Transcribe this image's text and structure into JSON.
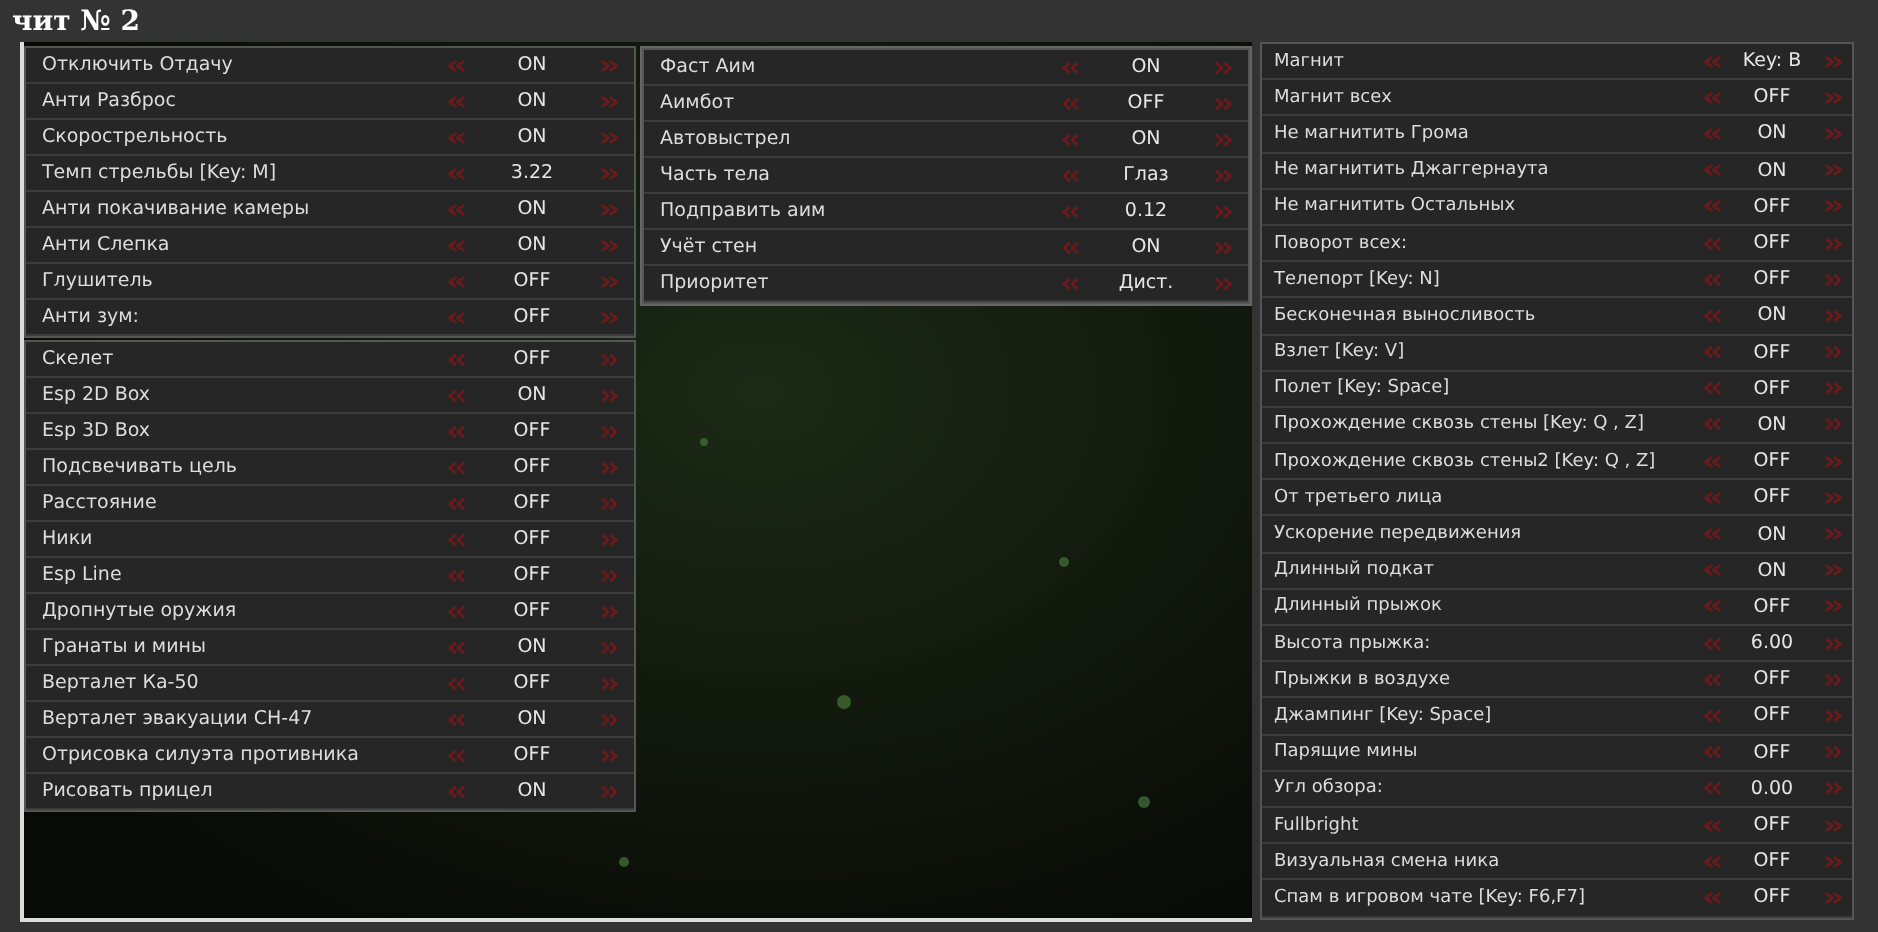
{
  "title": "чит № 2",
  "columns": [
    {
      "groups": [
        {
          "rows": [
            {
              "label": "Отключить Отдачу",
              "value": "ON"
            },
            {
              "label": "Анти Разброс",
              "value": "ON"
            },
            {
              "label": "Скорострельность",
              "value": "ON"
            },
            {
              "label": "Темп стрельбы [Key: M]",
              "value": "3.22"
            },
            {
              "label": "Анти покачивание камеры",
              "value": "ON"
            },
            {
              "label": "Анти Слепка",
              "value": "ON"
            },
            {
              "label": "Глушитель",
              "value": "OFF"
            },
            {
              "label": "Анти зум:",
              "value": "OFF"
            }
          ]
        },
        {
          "rows": [
            {
              "label": "Скелет",
              "value": "OFF"
            },
            {
              "label": "Esp 2D Box",
              "value": "ON"
            },
            {
              "label": "Esp 3D Box",
              "value": "OFF"
            },
            {
              "label": "Подсвечивать цель",
              "value": "OFF"
            },
            {
              "label": "Расстояние",
              "value": "OFF"
            },
            {
              "label": "Ники",
              "value": "OFF"
            },
            {
              "label": "Esp Line",
              "value": "OFF"
            },
            {
              "label": "Дропнутые оружия",
              "value": "OFF"
            },
            {
              "label": "Гранаты и мины",
              "value": "ON"
            },
            {
              "label": "Верталет Ка-50",
              "value": "OFF"
            },
            {
              "label": "Верталет эвакуации CH-47",
              "value": "ON"
            },
            {
              "label": "Отрисовка силуэта противника",
              "value": "OFF"
            },
            {
              "label": "Рисовать прицел",
              "value": "ON"
            }
          ]
        }
      ]
    },
    {
      "groups": [
        {
          "rows": [
            {
              "label": "Фаст Аим",
              "value": "ON"
            },
            {
              "label": "Аимбот",
              "value": "OFF"
            },
            {
              "label": "Автовыстрел",
              "value": "ON"
            },
            {
              "label": "Часть тела",
              "value": "Глаз"
            },
            {
              "label": "Подправить аим",
              "value": "0.12"
            },
            {
              "label": "Учёт стен",
              "value": "ON"
            },
            {
              "label": "Приоритет",
              "value": "Дист."
            }
          ]
        }
      ]
    },
    {
      "groups": [
        {
          "rows": [
            {
              "label": "Магнит",
              "value": "Key: B"
            },
            {
              "label": "Магнит всех",
              "value": "OFF"
            },
            {
              "label": "Не магнитить Грома",
              "value": "ON"
            },
            {
              "label": "Не магнитить Джаггернаута",
              "value": "ON"
            },
            {
              "label": "Не магнитить Остальных",
              "value": "OFF"
            },
            {
              "label": "Поворот всех:",
              "value": "OFF"
            },
            {
              "label": "Телепорт [Key: N]",
              "value": "OFF"
            },
            {
              "label": "Бесконечная выносливость",
              "value": "ON"
            },
            {
              "label": "Взлет [Key: V]",
              "value": "OFF"
            },
            {
              "label": "Полет [Key: Space]",
              "value": "OFF"
            },
            {
              "label": "Прохождение сквозь стены [Key: Q , Z]",
              "value": "ON"
            },
            {
              "label": "Прохождение сквозь стены2 [Key: Q , Z]",
              "value": "OFF"
            },
            {
              "label": "От третьего лица",
              "value": "OFF"
            },
            {
              "label": "Ускорение передвижения",
              "value": "ON"
            },
            {
              "label": "Длинный подкат",
              "value": "ON"
            },
            {
              "label": "Длинный прыжок",
              "value": "OFF"
            },
            {
              "label": "Высота прыжка:",
              "value": "6.00"
            },
            {
              "label": "Прыжки в воздухе",
              "value": "OFF"
            },
            {
              "label": "Джампинг [Key: Space]",
              "value": "OFF"
            },
            {
              "label": "Парящие мины",
              "value": "OFF"
            },
            {
              "label": "Угл обзора:",
              "value": "0.00"
            },
            {
              "label": "Fullbright",
              "value": "OFF"
            },
            {
              "label": "Визуальная смена ника",
              "value": "OFF"
            },
            {
              "label": "Спам в игровом чате [Key: F6,F7]",
              "value": "OFF"
            }
          ]
        }
      ]
    }
  ]
}
